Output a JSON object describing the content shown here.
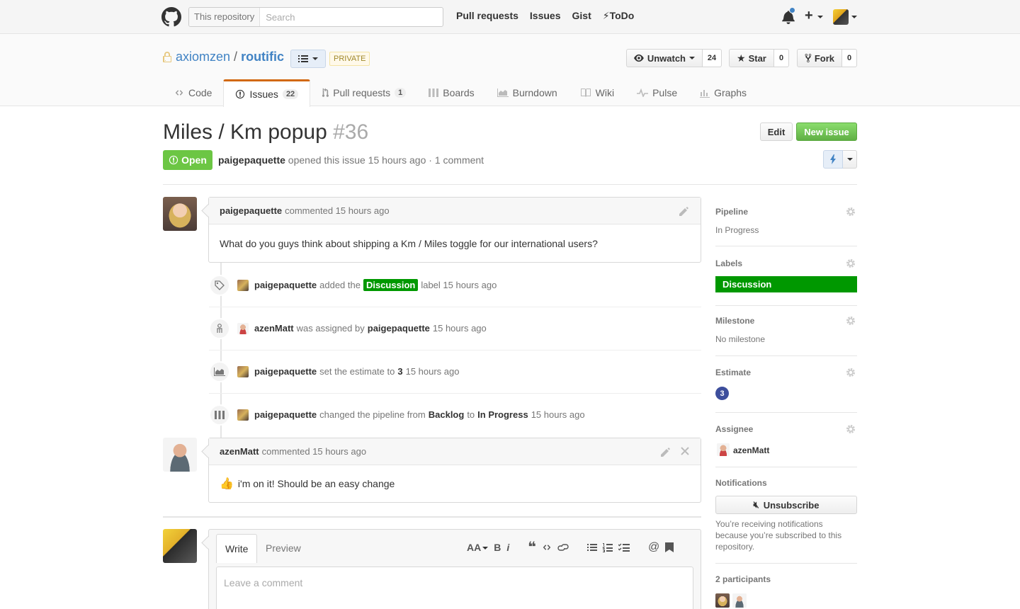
{
  "header": {
    "search_scope": "This repository",
    "search_placeholder": "Search",
    "nav": [
      "Pull requests",
      "Issues",
      "Gist",
      "ToDo"
    ]
  },
  "repo": {
    "owner": "axiomzen",
    "separator": "/",
    "name": "routific",
    "private_label": "PRIVATE",
    "unwatch_label": "Unwatch",
    "watch_count": "24",
    "star_label": "Star",
    "star_count": "0",
    "fork_label": "Fork",
    "fork_count": "0",
    "tabs": [
      {
        "label": "Code"
      },
      {
        "label": "Issues",
        "count": "22"
      },
      {
        "label": "Pull requests",
        "count": "1"
      },
      {
        "label": "Boards"
      },
      {
        "label": "Burndown"
      },
      {
        "label": "Wiki"
      },
      {
        "label": "Pulse"
      },
      {
        "label": "Graphs"
      }
    ]
  },
  "issue": {
    "title": "Miles / Km popup",
    "number": "#36",
    "edit_label": "Edit",
    "new_issue_label": "New issue",
    "state": "Open",
    "author": "paigepaquette",
    "meta_text": "opened this issue 15 hours ago · 1 comment"
  },
  "timeline": {
    "comment1": {
      "author": "paigepaquette",
      "meta": "commented 15 hours ago",
      "body": "What do you guys think about shipping a Km / Miles toggle for our international users?"
    },
    "events": {
      "e1": {
        "user": "paigepaquette",
        "t1": "added the",
        "label": "Discussion",
        "t2": "label 15 hours ago"
      },
      "e2": {
        "user": "azenMatt",
        "t1": "was assigned by",
        "by": "paigepaquette",
        "t2": "15 hours ago"
      },
      "e3": {
        "user": "paigepaquette",
        "t1": "set the estimate to",
        "value": "3",
        "t2": "15 hours ago"
      },
      "e4": {
        "user": "paigepaquette",
        "t1": "changed the pipeline from",
        "from": "Backlog",
        "to_word": "to",
        "to": "In Progress",
        "t2": "15 hours ago"
      }
    },
    "comment2": {
      "author": "azenMatt",
      "meta": "commented 15 hours ago",
      "emoji": "👍",
      "body": "i'm on it! Should be an easy change"
    }
  },
  "form": {
    "write_tab": "Write",
    "preview_tab": "Preview",
    "placeholder": "Leave a comment",
    "toolbar": {
      "heading": "AA",
      "bold": "B",
      "italic": "i",
      "mention": "@"
    }
  },
  "sidebar": {
    "pipeline": {
      "title": "Pipeline",
      "value": "In Progress"
    },
    "labels": {
      "title": "Labels",
      "value": "Discussion",
      "color": "#009800"
    },
    "milestone": {
      "title": "Milestone",
      "value": "No milestone"
    },
    "estimate": {
      "title": "Estimate",
      "value": "3"
    },
    "assignee": {
      "title": "Assignee",
      "value": "azenMatt"
    },
    "notifications": {
      "title": "Notifications",
      "button": "Unsubscribe",
      "note": "You’re receiving notifications because you’re subscribed to this repository."
    },
    "participants": {
      "title": "2 participants"
    }
  },
  "colors": {
    "accent": "#4183c4",
    "open_state": "#6cc644",
    "new_issue": "#60b044",
    "label_discussion": "#009800",
    "estimate_badge": "#3d4e9c",
    "selected_tab_border": "#d26911"
  }
}
